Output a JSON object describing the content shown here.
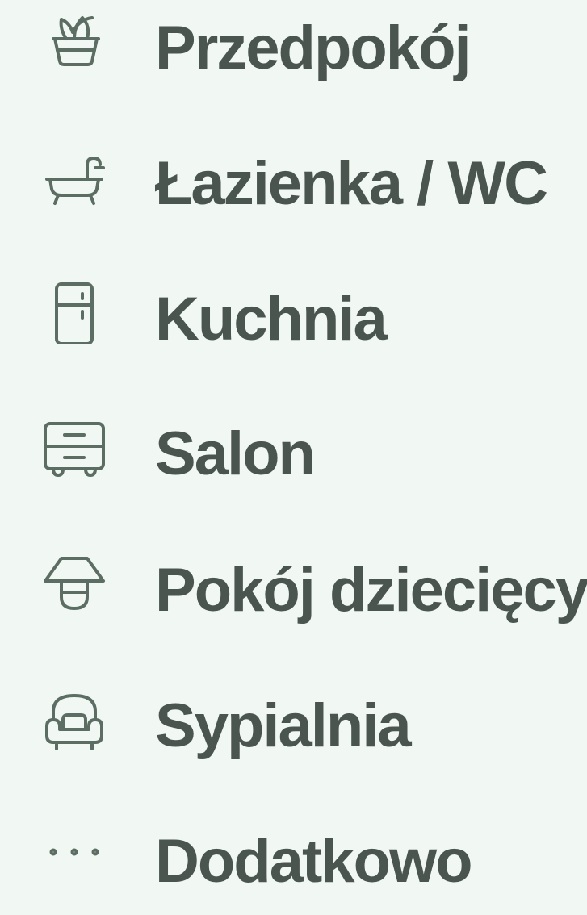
{
  "theme": {
    "background": "#f1f7f2",
    "text_color": "#4b5550",
    "icon_color": "#5c6d63"
  },
  "menu": {
    "items": [
      {
        "label": "Przedpokój",
        "icon": "plant-basket-icon"
      },
      {
        "label": "Łazienka / WC",
        "icon": "bathtub-icon"
      },
      {
        "label": "Kuchnia",
        "icon": "fridge-icon"
      },
      {
        "label": "Salon",
        "icon": "dresser-icon"
      },
      {
        "label": "Pokój dziecięcy",
        "icon": "lamp-icon"
      },
      {
        "label": "Sypialnia",
        "icon": "armchair-icon"
      },
      {
        "label": "Dodatkowo",
        "icon": "more-dots-icon"
      }
    ]
  }
}
